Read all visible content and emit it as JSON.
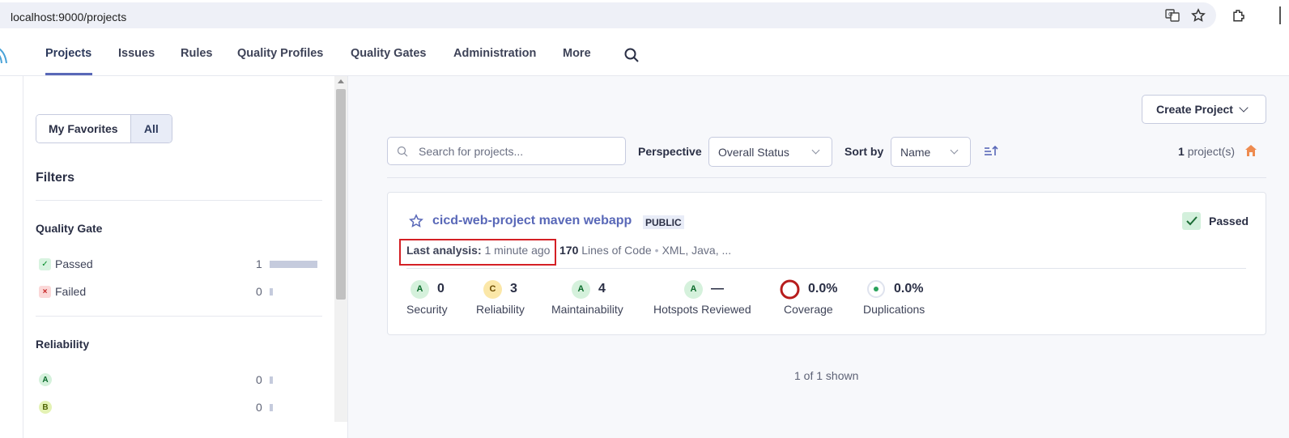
{
  "browser": {
    "url": "localhost:9000/projects"
  },
  "nav": {
    "items": [
      {
        "label": "Projects",
        "active": true
      },
      {
        "label": "Issues"
      },
      {
        "label": "Rules"
      },
      {
        "label": "Quality Profiles"
      },
      {
        "label": "Quality Gates"
      },
      {
        "label": "Administration"
      },
      {
        "label": "More"
      }
    ],
    "accent_color": "#5968b8"
  },
  "sidebar": {
    "toggle": {
      "favorites": "My Favorites",
      "all": "All",
      "selected": "All"
    },
    "filters_title": "Filters",
    "quality_gate": {
      "title": "Quality Gate",
      "items": [
        {
          "label": "Passed",
          "count": "1",
          "symbol": "✓",
          "share": 1.0
        },
        {
          "label": "Failed",
          "count": "0",
          "symbol": "×",
          "share": 0
        }
      ]
    },
    "reliability": {
      "title": "Reliability",
      "items": [
        {
          "grade": "A",
          "count": "0",
          "share": 0
        },
        {
          "grade": "B",
          "count": "0",
          "share": 0
        }
      ]
    }
  },
  "toolbar": {
    "create_project": "Create Project",
    "search_placeholder": "Search for projects...",
    "perspective_label": "Perspective",
    "perspective_value": "Overall Status",
    "sort_label": "Sort by",
    "sort_value": "Name",
    "project_count": "1",
    "project_count_suffix": "project(s)"
  },
  "project": {
    "name": "cicd-web-project maven webapp",
    "visibility": "PUBLIC",
    "status": "Passed",
    "last_analysis_label": "Last analysis:",
    "last_analysis_value": "1 minute ago",
    "loc_value": "170",
    "loc_label": "Lines of Code",
    "languages": "XML, Java, ...",
    "metrics": [
      {
        "label": "Security",
        "grade": "A",
        "value": "0"
      },
      {
        "label": "Reliability",
        "grade": "C",
        "value": "3"
      },
      {
        "label": "Maintainability",
        "grade": "A",
        "value": "4"
      },
      {
        "label": "Hotspots Reviewed",
        "grade": "A",
        "value": "—"
      },
      {
        "label": "Coverage",
        "value": "0.0%"
      },
      {
        "label": "Duplications",
        "value": "0.0%"
      }
    ]
  },
  "footer": {
    "shown": "1 of 1 shown"
  }
}
